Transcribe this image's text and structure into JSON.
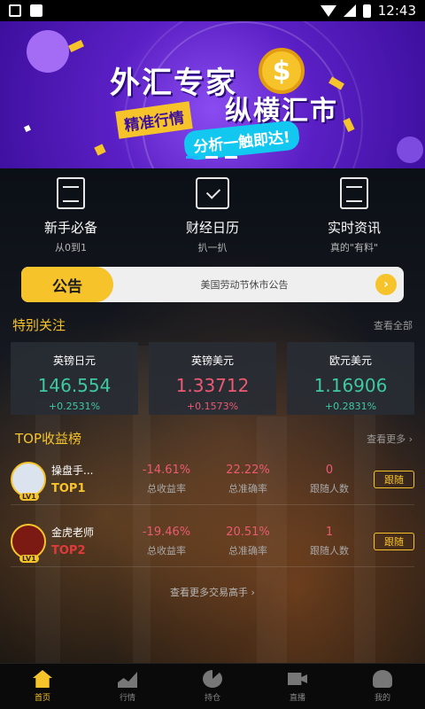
{
  "status_bar": {
    "time": "12:43"
  },
  "banner": {
    "title": "外汇专家",
    "subtitle": "纵横汇市",
    "tag": "精准行情",
    "pill": "分析一触即达!",
    "coin_symbol": "$"
  },
  "quick_menu": [
    {
      "title": "新手必备",
      "sub": "从0到1",
      "icon": "document-icon"
    },
    {
      "title": "财经日历",
      "sub": "扒一扒",
      "icon": "calendar-icon"
    },
    {
      "title": "实时资讯",
      "sub": "真的\"有料\"",
      "icon": "news-icon"
    }
  ],
  "notice": {
    "tag": "公告",
    "text": "美国劳动节休市公告",
    "arrow": "›"
  },
  "special_focus": {
    "title": "特别关注",
    "link": "查看全部",
    "items": [
      {
        "name": "英镑日元",
        "price": "146.554",
        "change": "+0.2531%",
        "color": "#3ec9a0"
      },
      {
        "name": "英镑美元",
        "price": "1.33712",
        "change": "+0.1573%",
        "color": "#ec5a72"
      },
      {
        "name": "欧元美元",
        "price": "1.16906",
        "change": "+0.2831%",
        "color": "#3ec9a0"
      }
    ]
  },
  "top_rank": {
    "title": "TOP收益榜",
    "link": "查看更多 ›",
    "stat_labels": {
      "profit": "总收益率",
      "accuracy": "总准确率",
      "followers": "跟随人数"
    },
    "rows": [
      {
        "name": "操盘手...",
        "rank": "TOP1",
        "level": "LV1",
        "profit": "-14.61%",
        "accuracy": "22.22%",
        "followers": "0",
        "follow": "跟随"
      },
      {
        "name": "金虎老师",
        "rank": "TOP2",
        "level": "LV1",
        "profit": "-19.46%",
        "accuracy": "20.51%",
        "followers": "1",
        "follow": "跟随"
      }
    ],
    "more": "查看更多交易高手  ›"
  },
  "tab_bar": [
    {
      "label": "首页",
      "icon": "home-icon",
      "active": true
    },
    {
      "label": "行情",
      "icon": "chart-icon",
      "active": false
    },
    {
      "label": "持仓",
      "icon": "pie-icon",
      "active": false
    },
    {
      "label": "直播",
      "icon": "live-icon",
      "active": false
    },
    {
      "label": "我的",
      "icon": "user-icon",
      "active": false
    }
  ],
  "colors": {
    "accent": "#f6c42a",
    "up": "#3ec9a0",
    "down": "#ec5a72"
  }
}
